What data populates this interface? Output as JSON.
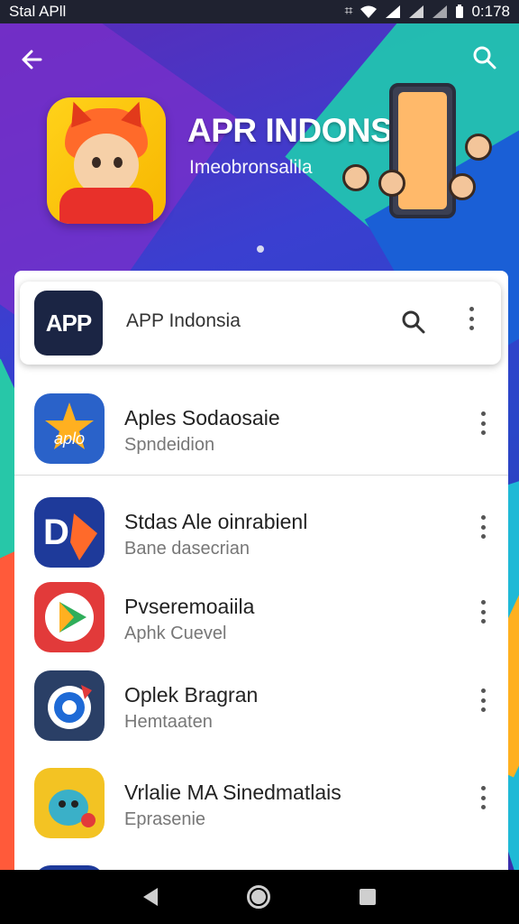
{
  "status_bar": {
    "left_text": "Stal APll",
    "time": "0:178",
    "icons": [
      "nfc-icon",
      "wifi-icon",
      "signal-icon",
      "signal-icon",
      "signal-icon",
      "battery-icon"
    ]
  },
  "top_bar": {
    "back_icon": "arrow-left-icon",
    "search_icon": "search-icon"
  },
  "banner": {
    "title": "APR INDONSIA",
    "subtitle": "Imeobronsalila",
    "page_indicator": "1"
  },
  "search_card": {
    "logo_text": "APP",
    "title": "APP Indonsia"
  },
  "apps": [
    {
      "name": "Aples Sodaosaie",
      "subtitle": "Spndeidion",
      "icon_color": "#2a62c9"
    },
    {
      "name": "Stdas Ale oinrabienl",
      "subtitle": "Bane dasecrian",
      "icon_color": "#1e3a9a"
    },
    {
      "name": "Pvseremoaiila",
      "subtitle": "Aphk Cuevel",
      "icon_color": "#e23a3a"
    },
    {
      "name": "Oplek Bragran",
      "subtitle": "Hemtaaten",
      "icon_color": "#2a3f66"
    },
    {
      "name": "Vrlalie MA Sinedmatlais",
      "subtitle": "Eprasenie",
      "icon_color": "#f3c323"
    }
  ],
  "navbar": {
    "back_icon": "nav-back-icon",
    "home_icon": "nav-home-icon",
    "recents_icon": "nav-recents-icon"
  },
  "colors": {
    "status_bg": "#1f2230",
    "nav_bg": "#000000",
    "accent_orange": "#ff8a2a"
  }
}
